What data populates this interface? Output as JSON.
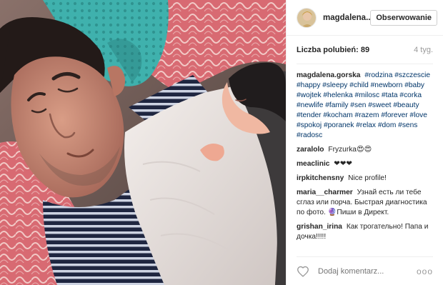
{
  "post": {
    "username": "magdalena....",
    "follow_label": "Obserwowanie",
    "likes_text": "Liczba polubień: 89",
    "time_ago": "4 tyg.",
    "caption": {
      "author": "magdalena.gorska",
      "hashtags": "#rodzina #szczescie #happy #sleepy #child #newborn #baby #wojtek #helenka #milosc #tata #corka #newlife #family #sen #sweet #beauty #tender #kocham #razem #forever #love #spokoj #poranek #relax #dom #sens #radosc"
    },
    "comments": [
      {
        "author": "zaralolo",
        "text": "Fryzurka😍😍"
      },
      {
        "author": "meaclinic",
        "text": "❤❤❤"
      },
      {
        "author": "irpkitchensny",
        "text": "Nice profile!"
      },
      {
        "author": "maria__charmer",
        "text": "Узнай есть ли тебе сглаз или порча. Быстрая диагностика по фото. 🔮Пиши в Директ."
      },
      {
        "author": "grishan_irina",
        "text": "Как трогательно! Папа и дочка!!!!!"
      }
    ],
    "add_comment_placeholder": "Dodaj komentarz...",
    "more_glyph": "ooo"
  },
  "icons": {
    "like": "heart-outline-icon",
    "more": "more-options-icon",
    "avatar": "profile-avatar"
  },
  "colors": {
    "hashtag": "#003569",
    "border": "#efefef",
    "muted": "#999999",
    "text": "#262626"
  }
}
